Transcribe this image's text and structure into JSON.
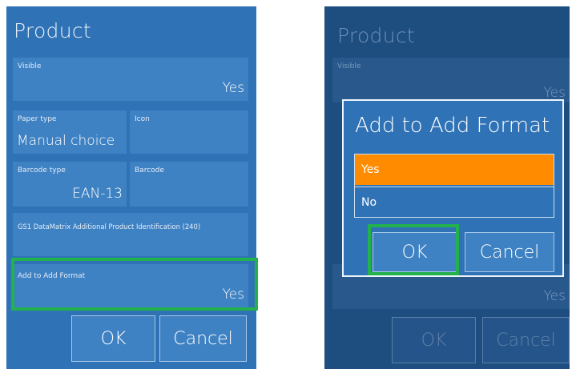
{
  "left": {
    "title": "Product",
    "fields": {
      "visible": {
        "label": "Visible",
        "value": "Yes"
      },
      "paper_type": {
        "label": "Paper type",
        "value": "Manual choice"
      },
      "icon": {
        "label": "Icon",
        "value": ""
      },
      "barcode_type": {
        "label": "Barcode type",
        "value": "EAN-13"
      },
      "barcode": {
        "label": "Barcode",
        "value": ""
      },
      "gs1": {
        "label": "GS1 DataMatrix Additional Product Identification (240)",
        "value": ""
      },
      "add_format": {
        "label": "Add to Add Format",
        "value": "Yes"
      }
    },
    "ok_label": "OK",
    "cancel_label": "Cancel"
  },
  "right": {
    "title": "Product",
    "visible_label": "Visible",
    "visible_value": "Yes",
    "bottom_value": "Yes",
    "ok_label": "OK",
    "cancel_label": "Cancel",
    "dialog": {
      "title": "Add to Add Format",
      "options": [
        "Yes",
        "No"
      ],
      "selected": "Yes",
      "ok_label": "OK",
      "cancel_label": "Cancel"
    }
  },
  "colors": {
    "panel_bg": "#2f72b6",
    "dimmed_panel_bg": "#1e4e80",
    "selected_option": "#ff8c00",
    "highlight_border": "#22b14c"
  }
}
